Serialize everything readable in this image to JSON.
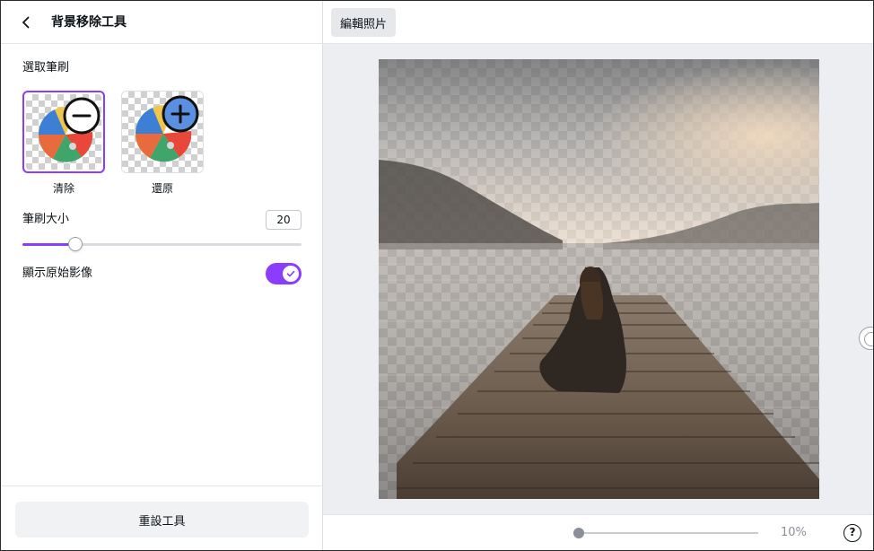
{
  "panel": {
    "title": "背景移除工具",
    "back_icon": "chevron-left-icon",
    "brush_section_label": "選取筆刷",
    "brushes": [
      {
        "label": "清除",
        "icon": "minus-circle-icon",
        "selected": true
      },
      {
        "label": "還原",
        "icon": "plus-circle-icon",
        "selected": false
      }
    ],
    "brush_size_label": "筆刷大小",
    "brush_size_value": "20",
    "brush_size_fraction": 0.19,
    "show_original_label": "顯示原始影像",
    "show_original_on": true,
    "reset_label": "重設工具"
  },
  "topbar": {
    "edit_photo_label": "編輯照片"
  },
  "canvas": {
    "zoom_label": "10%",
    "zoom_fraction": 0.0,
    "help_label": "?"
  },
  "colors": {
    "accent": "#8b3dff",
    "canvas_bg": "#eceef1"
  }
}
